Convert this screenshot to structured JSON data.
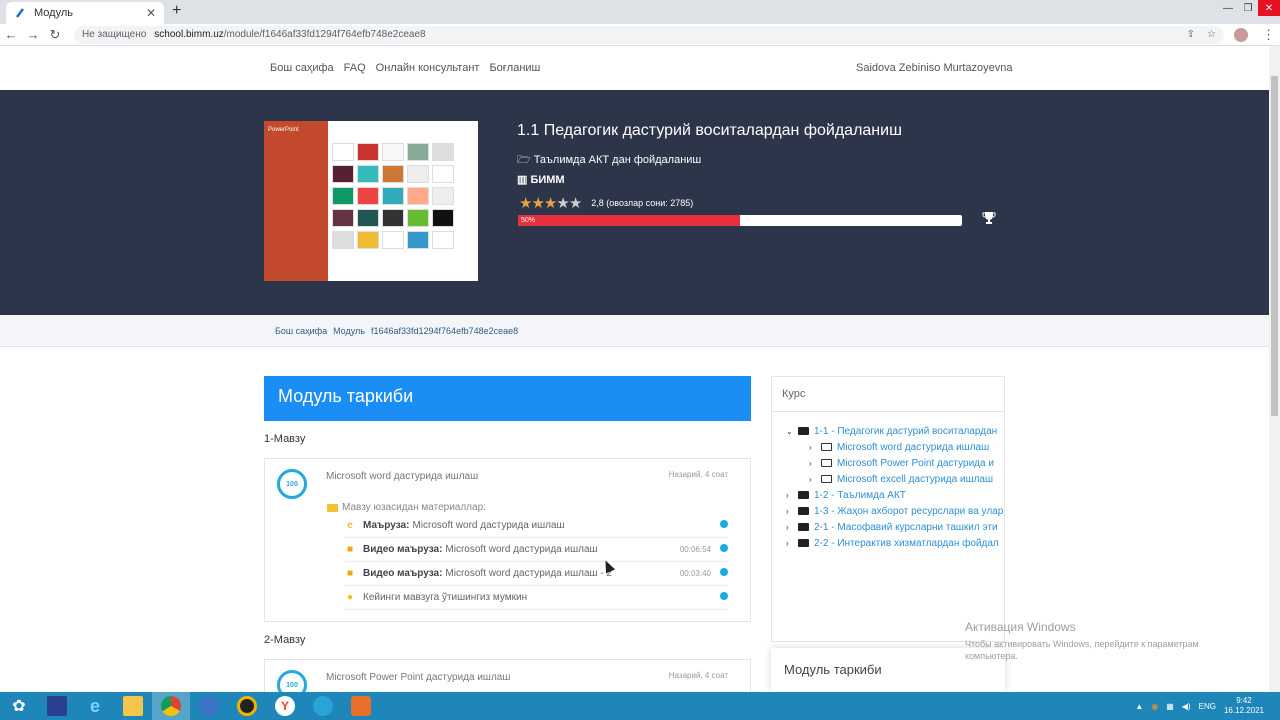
{
  "browser": {
    "tab_title": "Модуль",
    "insecure_label": "Не защищено",
    "url_host": "school.bimm.uz",
    "url_path": "/module/f1646af33fd1294f764efb748e2ceae8"
  },
  "nav": {
    "links": [
      "Бош саҳифа",
      "FAQ",
      "Онлайн консультант",
      "Боғланиш"
    ],
    "user": "Saidova Zebiniso Murtazoyevna"
  },
  "hero": {
    "thumbnail_label": "PowerPoint",
    "title": "1.1 Педагогик дастурий воситалардан фойдаланиш",
    "category": "Таълимда АКТ дан фойдаланиш",
    "org": "БИММ",
    "rating_stars": 2.8,
    "rating_text": "2,8 (овозлар сони: 2785)",
    "progress_label": "50%",
    "progress_fraction": 0.5
  },
  "breadcrumb": [
    "Бош саҳифа",
    "Модуль",
    "f1646af33fd1294f764efb748e2ceae8"
  ],
  "main": {
    "heading": "Модуль таркиби",
    "topics": [
      {
        "label": "1-Мавзу",
        "badge": "100",
        "title": "Microsoft word дастурида ишлаш",
        "meta": "Назарий, 4 соат",
        "materials_label": "Мавзу юзасидан материаллар:",
        "materials": [
          {
            "icon": "ie-icon",
            "kind": "Маъруза:",
            "text": "Microsoft word дастурида ишлаш",
            "duration": ""
          },
          {
            "icon": "video-icon",
            "kind": "Видео маъруза:",
            "text": "Microsoft word дастурида ишлаш",
            "duration": "00:06:54"
          },
          {
            "icon": "video-icon",
            "kind": "Видео маъруза:",
            "text": "Microsoft word дастурида ишлаш - 2",
            "duration": "00:03:40"
          },
          {
            "icon": "check-circle-icon",
            "kind": "",
            "text": "Кейинги мавзуга ўтишингиз мумкин",
            "duration": ""
          }
        ]
      },
      {
        "label": "2-Мавзу",
        "badge": "100",
        "title": "Microsoft Power Point дастурида ишлаш",
        "meta": "Назарий, 4 соат"
      }
    ]
  },
  "sidebar": {
    "course_head": "Курс",
    "tree": [
      {
        "label": "1-1 - Педагогик дастурий воситалардан",
        "level": 0,
        "open": true
      },
      {
        "label": "Microsoft word дастурида ишлаш",
        "level": 1
      },
      {
        "label": "Microsoft Power Point дастурида и",
        "level": 1
      },
      {
        "label": "Microsoft excell дастурида ишлаш",
        "level": 1
      },
      {
        "label": "1-2 - Таълимда АКТ",
        "level": 0
      },
      {
        "label": "1-3 - Жаҳон ахборот ресурслари ва улар",
        "level": 0
      },
      {
        "label": "2-1 - Масофавий курсларни ташкил эти",
        "level": 0
      },
      {
        "label": "2-2 - Интерактив хизматлардан фойдал",
        "level": 0
      }
    ],
    "module_box": "Модуль таркиби"
  },
  "os": {
    "activate_title": "Активация Windows",
    "activate_sub": "Чтобы активировать Windows, перейдите к параметрам компьютера.",
    "lang": "ENG",
    "time": "9:42",
    "date": "16.12.2021"
  },
  "colors": {
    "hero_bg": "#2c3549",
    "accent": "#1a8ef5",
    "progress": "#e6303d"
  }
}
